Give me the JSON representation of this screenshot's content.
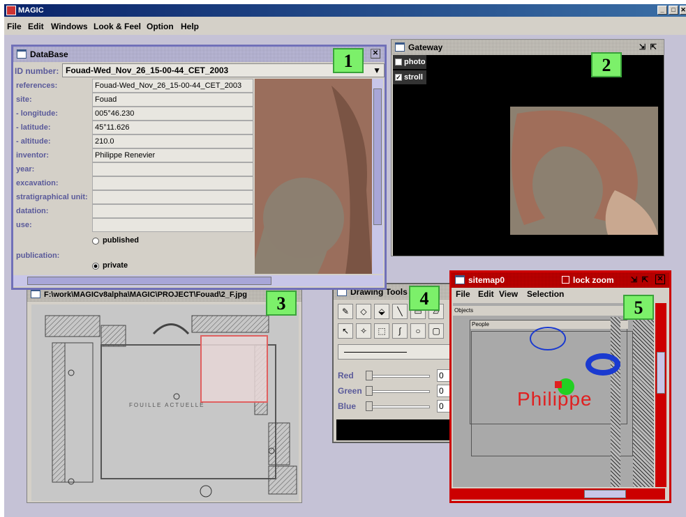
{
  "app": {
    "title": "MAGIC"
  },
  "menu": [
    "File",
    "Edit",
    "Windows",
    "Look & Feel",
    "Option",
    "Help"
  ],
  "database": {
    "title": "DataBase",
    "id_label": "ID number:",
    "id_value": "Fouad-Wed_Nov_26_15-00-44_CET_2003",
    "rows": [
      {
        "label": "references:",
        "value": "Fouad-Wed_Nov_26_15-00-44_CET_2003"
      },
      {
        "label": "site:",
        "value": "Fouad"
      },
      {
        "label": " - longitude:",
        "value": "005°46.230"
      },
      {
        "label": " - latitude:",
        "value": "45°11.626"
      },
      {
        "label": " - altitude:",
        "value": "210.0"
      },
      {
        "label": "inventor:",
        "value": "Philippe Renevier"
      },
      {
        "label": "year:",
        "value": ""
      },
      {
        "label": "excavation:",
        "value": ""
      },
      {
        "label": "stratigraphical unit:",
        "value": ""
      },
      {
        "label": "datation:",
        "value": ""
      },
      {
        "label": "use:",
        "value": ""
      }
    ],
    "publication_label": "publication:",
    "published_label": "published",
    "private_label": "private",
    "badge": "1"
  },
  "gateway": {
    "title": "Gateway",
    "photo_label": "photo",
    "stroll_label": "stroll",
    "badge": "2"
  },
  "image_window": {
    "title": "F:\\work\\MAGICv8alpha\\MAGIC\\PROJECT\\Fouad\\2_F.jpg",
    "plan_text": "FOUILLE  ACTUELLE",
    "badge": "3"
  },
  "drawing_tools": {
    "title": "Drawing Tools",
    "red_label": "Red",
    "green_label": "Green",
    "blue_label": "Blue",
    "red_value": "0",
    "green_value": "0",
    "blue_value": "0",
    "badge": "4"
  },
  "sitemap": {
    "title": "sitemap0",
    "lock_zoom_label": "lock zoom",
    "menu": [
      "File",
      "Edit",
      "View",
      "Selection"
    ],
    "objects_label": "Objects",
    "people_label": "People",
    "name_label": "Philippe",
    "badge": "5"
  },
  "colors": {
    "accent": "#0a246a",
    "sitemap_border": "#cc0000",
    "badge_green": "#7cf06a"
  }
}
